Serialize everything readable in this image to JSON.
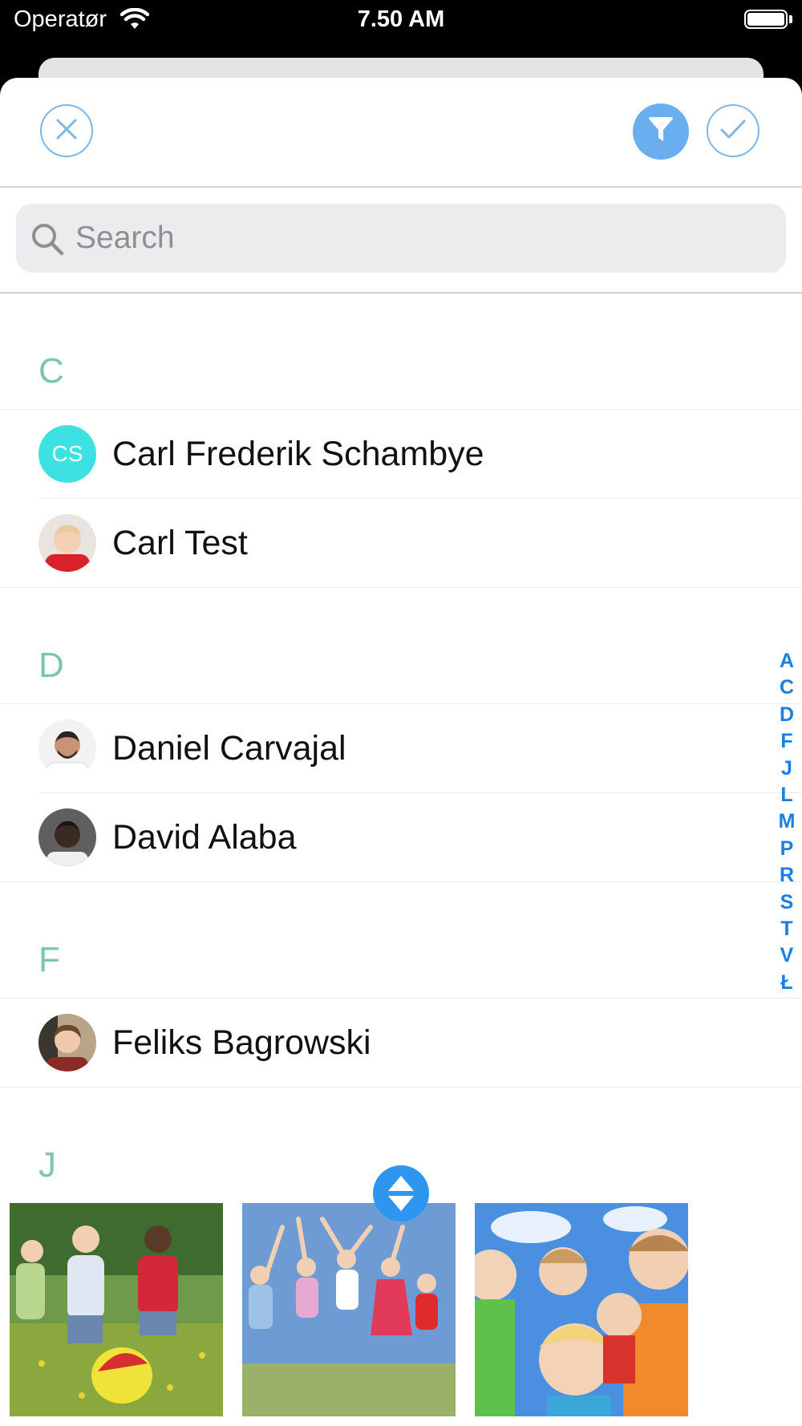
{
  "status_bar": {
    "carrier": "Operatør",
    "time": "7.50 AM"
  },
  "search": {
    "placeholder": "Search"
  },
  "sections": [
    {
      "letter": "C",
      "contacts": [
        {
          "name": "Carl Frederik Schambye",
          "initials": "CS",
          "avatar": "initials"
        },
        {
          "name": "Carl Test",
          "avatar": "photo"
        }
      ]
    },
    {
      "letter": "D",
      "contacts": [
        {
          "name": "Daniel Carvajal",
          "avatar": "photo"
        },
        {
          "name": "David Alaba",
          "avatar": "photo"
        }
      ]
    },
    {
      "letter": "F",
      "contacts": [
        {
          "name": "Feliks Bagrowski",
          "avatar": "photo"
        }
      ]
    },
    {
      "letter": "J",
      "contacts": []
    }
  ],
  "index_letters": [
    "A",
    "C",
    "D",
    "F",
    "J",
    "L",
    "M",
    "P",
    "R",
    "S",
    "T",
    "V",
    "Ł"
  ],
  "colors": {
    "accent": "#2f96f0",
    "section_letter": "#7cc6a9",
    "index": "#1a7fe0",
    "initials_avatar": "#3ee1e1"
  },
  "icons": {
    "close": "close-icon",
    "filter": "filter-icon",
    "done": "checkmark-icon",
    "search": "magnifier-icon",
    "handle": "up-down-arrows-icon"
  }
}
